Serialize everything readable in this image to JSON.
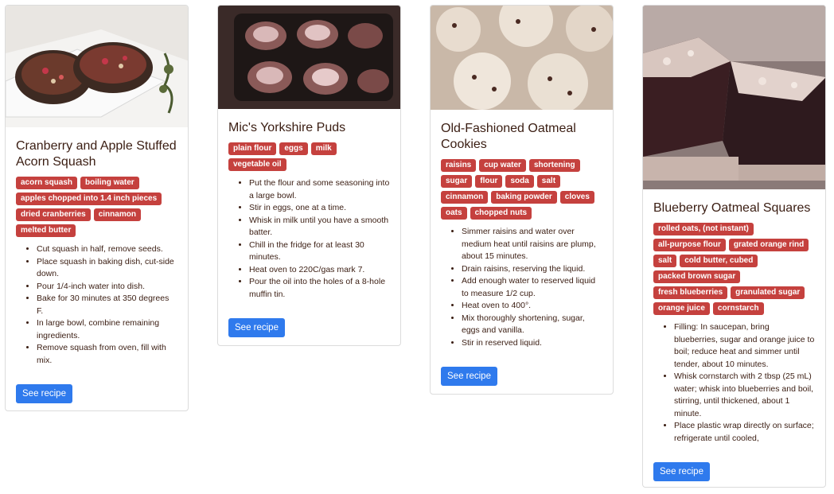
{
  "cards": [
    {
      "title": "Cranberry and Apple Stuffed Acorn Squash",
      "tags": [
        "acorn squash",
        "boiling water",
        "apples chopped into 1.4 inch pieces",
        "dried cranberries",
        "cinnamon",
        "melted butter"
      ],
      "steps": [
        "Cut squash in half, remove seeds.",
        "Place squash in baking dish, cut-side down.",
        "Pour 1/4-inch water into dish.",
        "Bake for 30 minutes at 350 degrees F.",
        "In large bowl, combine remaining ingredients.",
        "Remove squash from oven, fill with mix."
      ],
      "button": "See recipe",
      "image_icon": "acorn-squash-photo"
    },
    {
      "title": "Mic's Yorkshire Puds",
      "tags": [
        "plain flour",
        "eggs",
        "milk",
        "vegetable oil"
      ],
      "steps": [
        "Put the flour and some seasoning into a large bowl.",
        "Stir in eggs, one at a time.",
        "Whisk in milk until you have a smooth batter.",
        "Chill in the fridge for at least 30 minutes.",
        "Heat oven to 220C/gas mark 7.",
        "Pour the oil into the holes of a 8-hole muffin tin."
      ],
      "button": "See recipe",
      "image_icon": "yorkshire-puds-photo"
    },
    {
      "title": "Old-Fashioned Oatmeal Cookies",
      "tags": [
        "raisins",
        "cup water",
        "shortening",
        "sugar",
        "flour",
        "soda",
        "salt",
        "cinnamon",
        "baking powder",
        "cloves",
        "oats",
        "chopped nuts"
      ],
      "steps": [
        "Simmer raisins and water over medium heat until raisins are plump, about 15 minutes.",
        "Drain raisins, reserving the liquid.",
        "Add enough water to reserved liquid to measure 1/2 cup.",
        "Heat oven to 400°.",
        "Mix thoroughly shortening, sugar, eggs and vanilla.",
        "Stir in reserved liquid."
      ],
      "button": "See recipe",
      "image_icon": "oatmeal-cookies-photo"
    },
    {
      "title": "Blueberry Oatmeal Squares",
      "tags": [
        "rolled oats, (not instant)",
        "all-purpose flour",
        "grated orange rind",
        "salt",
        "cold butter, cubed",
        "packed brown sugar",
        "fresh blueberries",
        "granulated sugar",
        "orange juice",
        "cornstarch"
      ],
      "steps": [
        "Filling: In saucepan, bring blueberries, sugar and orange juice to boil; reduce heat and simmer until tender, about 10 minutes.",
        "Whisk cornstarch with 2 tbsp (25 mL) water; whisk into blueberries and boil, stirring, until thickened, about 1 minute.",
        "Place plastic wrap directly on surface; refrigerate until cooled,"
      ],
      "button": "See recipe",
      "image_icon": "blueberry-squares-photo"
    }
  ]
}
